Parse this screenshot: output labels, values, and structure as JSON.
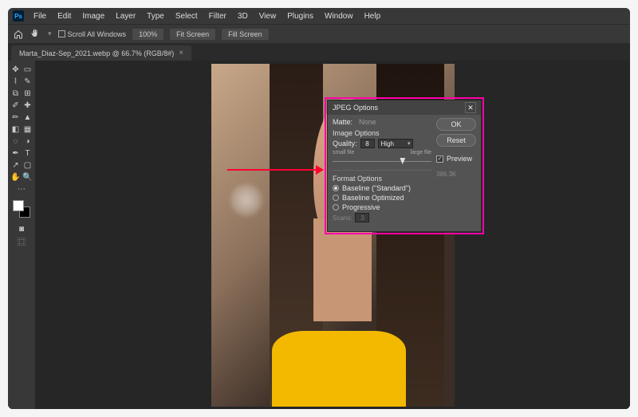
{
  "logo_text": "Ps",
  "menu": [
    "File",
    "Edit",
    "Image",
    "Layer",
    "Type",
    "Select",
    "Filter",
    "3D",
    "View",
    "Plugins",
    "Window",
    "Help"
  ],
  "optionsbar": {
    "scroll_all": "Scroll All Windows",
    "zoom": "100%",
    "fit": "Fit Screen",
    "fill": "Fill Screen"
  },
  "tab": {
    "label": "Marta_Diaz-Sep_2021.webp @ 66.7% (RGB/8#)",
    "close": "×"
  },
  "dialog": {
    "title": "JPEG Options",
    "tabs": {
      "matte": "Matte:",
      "none": "None"
    },
    "image_options": "Image Options",
    "quality_label": "Quality:",
    "quality_value": "8",
    "quality_preset": "High",
    "slider": {
      "small": "small file",
      "large": "large file"
    },
    "format_options": "Format Options",
    "baseline_std": "Baseline (\"Standard\")",
    "baseline_opt": "Baseline Optimized",
    "progressive": "Progressive",
    "scans_label": "Scans:",
    "scans_value": "3",
    "ok": "OK",
    "reset": "Reset",
    "preview": "Preview",
    "filesize": "386.3K"
  }
}
